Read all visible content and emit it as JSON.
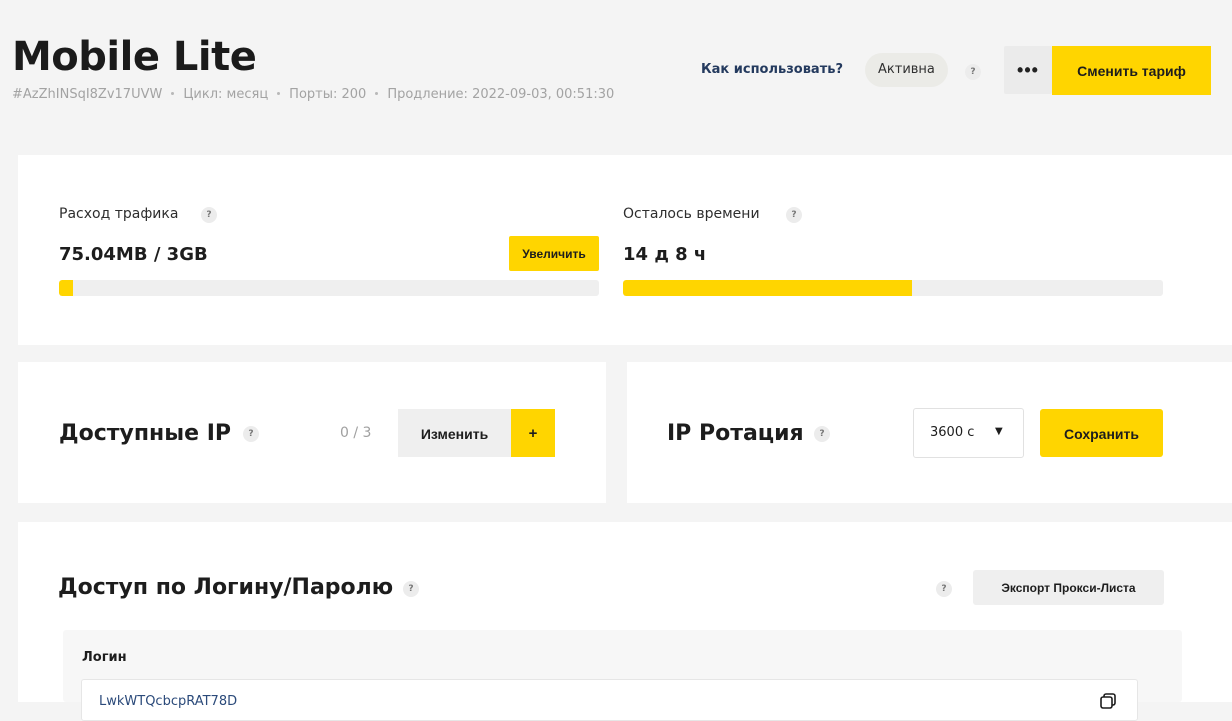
{
  "header": {
    "title": "Mobile Lite",
    "id": "#AzZhINSqI8Zv17UVW",
    "cycle": "Цикл: месяц",
    "ports": "Порты: 200",
    "renewal": "Продление: 2022-09-03, 00:51:30",
    "how_to_use": "Как использовать?",
    "status": "Активна",
    "more_label": "•••",
    "change_plan": "Сменить тариф"
  },
  "traffic": {
    "label": "Расход трафика",
    "value": "75.04MB / 3GB",
    "progress": 0.025,
    "increase_button": "Увеличить"
  },
  "time_left": {
    "label": "Осталось времени",
    "value": "14 д 8 ч",
    "progress": 0.535
  },
  "available_ips": {
    "title": "Доступные IP",
    "count": "0 / 3",
    "edit_button": "Изменить",
    "add_button": "+"
  },
  "ip_rotation": {
    "title": "IP Ротация",
    "selected": "3600 с",
    "save_button": "Сохранить"
  },
  "auth": {
    "title": "Доступ по Логину/Паролю",
    "export_button": "Экспорт Прокси-Листа",
    "login_label": "Логин",
    "login_value": "LwkWTQcbcpRAT78D"
  },
  "help_glyph": "?",
  "colors": {
    "accent": "#ffd500",
    "background": "#f4f4f4",
    "card": "#ffffff",
    "link": "#243a5e"
  }
}
